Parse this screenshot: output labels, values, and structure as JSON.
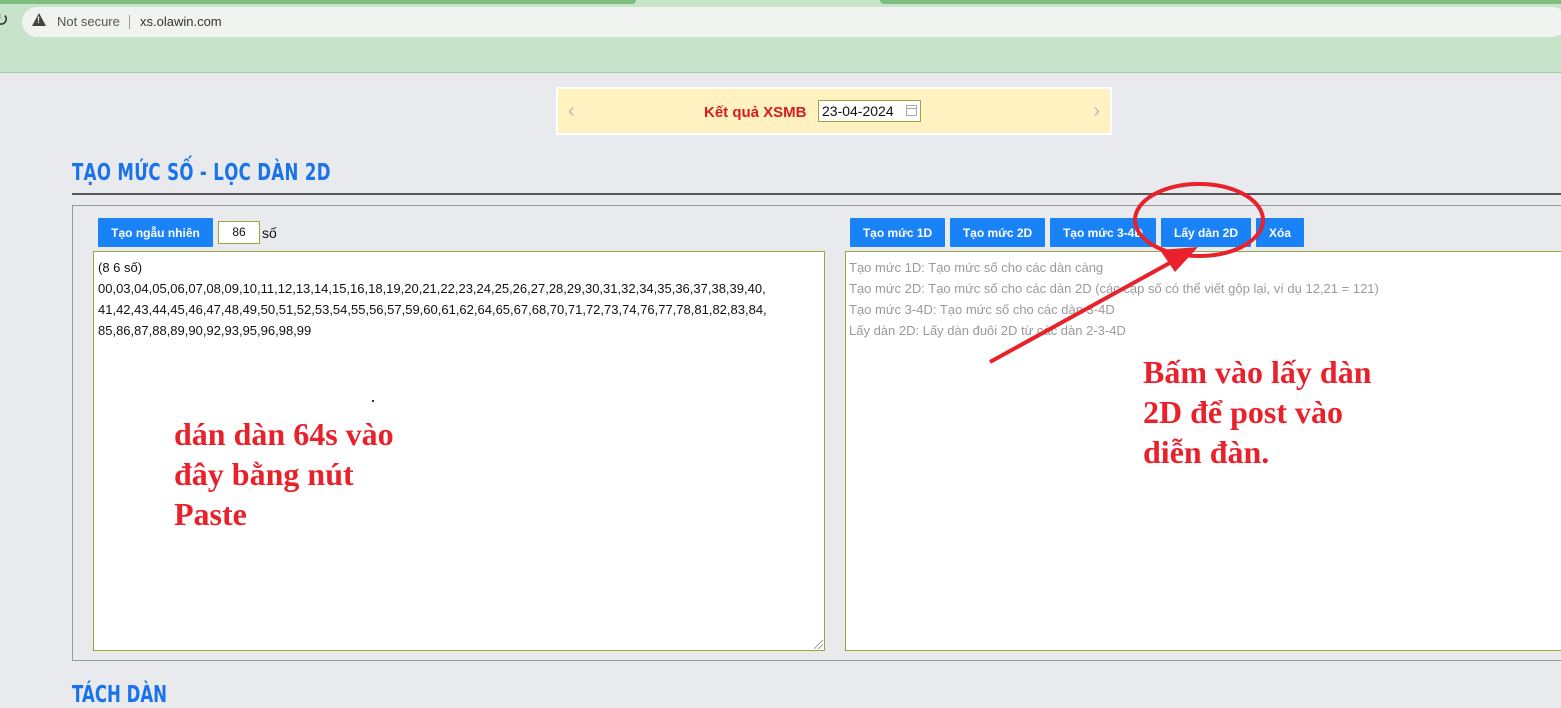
{
  "browser": {
    "security_text": "Not secure",
    "url": "xs.olawin.com"
  },
  "date_bar": {
    "label": "Kết quả XSMB",
    "date_value": "23-04-2024"
  },
  "section_title": "TẠO MỨC SỐ - LỌC DÀN 2D",
  "next_section_title": "TÁCH DÀN",
  "left_panel": {
    "random_button": "Tạo ngẫu nhiên",
    "count_value": "86",
    "count_unit": "số",
    "textarea_lines": [
      "(8 6 số)",
      "00,03,04,05,06,07,08,09,10,11,12,13,14,15,16,18,19,20,21,22,23,24,25,26,27,28,29,30,31,32,34,35,36,37,38,39,40,",
      "41,42,43,44,45,46,47,48,49,50,51,52,53,54,55,56,57,59,60,61,62,64,65,67,68,70,71,72,73,74,76,77,78,81,82,83,84,",
      "85,86,87,88,89,90,92,93,95,96,98,99"
    ]
  },
  "right_panel": {
    "buttons": [
      "Tạo mức 1D",
      "Tạo mức 2D",
      "Tạo mức 3-4D",
      "Lấy dàn 2D",
      "Xóa"
    ],
    "placeholder_lines": [
      "Tạo mức 1D: Tạo mức số cho các dàn càng",
      "Tạo mức 2D: Tạo mức số cho các dàn 2D (các cặp số có thể viết gộp lại, ví dụ 12,21 = 121)",
      "Tạo mức 3-4D: Tạo mức số cho các dàn 3-4D",
      "Lấy dàn 2D: Lấy dàn đuôi 2D từ các dàn 2-3-4D"
    ]
  },
  "annotations": {
    "left_note": [
      "dán dàn 64s vào",
      "đây bằng nút",
      "Paste"
    ],
    "right_note": [
      "Bấm vào lấy dàn",
      "2D để post vào",
      "diễn đàn."
    ],
    "color": "#e8212b"
  }
}
